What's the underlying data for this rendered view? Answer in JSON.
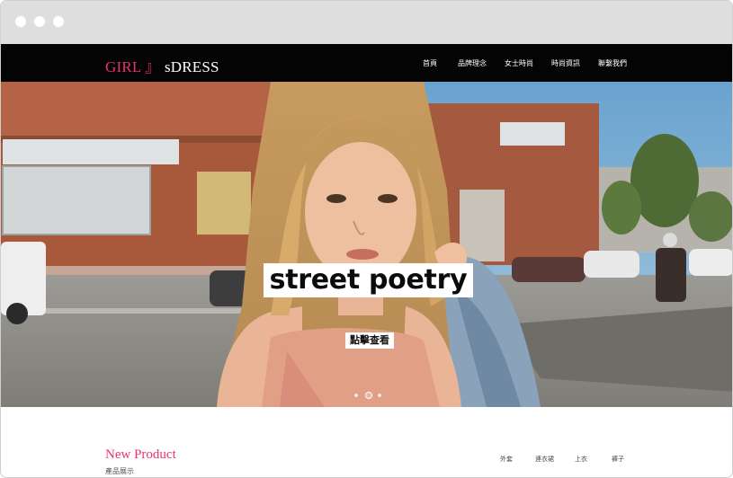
{
  "site": {
    "logo": {
      "part1": "GIRL",
      "part2": "』",
      "part3": "sDRESS"
    },
    "nav": [
      "首頁",
      "品牌理念",
      "女士時尚",
      "時尚資訊",
      "聯繫我們"
    ]
  },
  "hero": {
    "title": "street poetry",
    "cta": "點擊查看",
    "slides_total": 3,
    "slide_active": 2
  },
  "products": {
    "title": "New Product",
    "subtitle": "產品展示",
    "tabs": [
      "外套",
      "連衣裙",
      "上衣",
      "褲子"
    ]
  },
  "colors": {
    "accent": "#e8336e",
    "navbar": "#040404",
    "window_chrome": "#dedede"
  }
}
